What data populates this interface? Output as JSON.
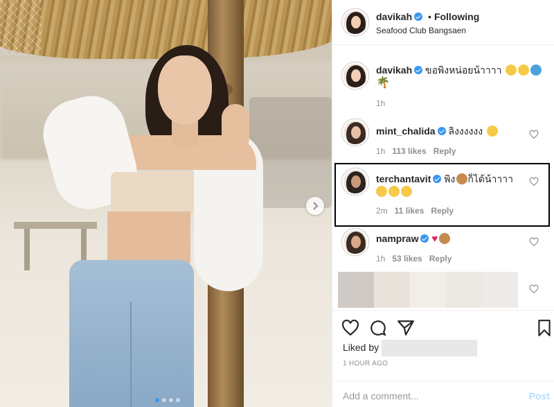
{
  "post": {
    "username": "davikah",
    "follow_status": "Following",
    "location": "Seafood Club Bangsaen"
  },
  "comments": [
    {
      "username": "davikah",
      "text": "ขอพิงหน่อยน้าาาา",
      "emojis": [
        "smile",
        "yum",
        "wave",
        "palm"
      ],
      "time": "1h"
    },
    {
      "username": "mint_chalida",
      "text": "ลิงงงงงง",
      "emojis": [
        "heart-eyes"
      ],
      "time": "1h",
      "likes": "113 likes",
      "reply": "Reply"
    },
    {
      "username": "terchantavit",
      "text_before": "พิง",
      "text_after": "ก็ได้น้าาาา",
      "emojis": [
        "monkey",
        "rofl",
        "rofl",
        "rofl"
      ],
      "time": "2m",
      "likes": "11 likes",
      "reply": "Reply"
    },
    {
      "username": "nampraw",
      "emojis": [
        "red-heart",
        "see-no-evil"
      ],
      "time": "1h",
      "likes": "53 likes",
      "reply": "Reply"
    }
  ],
  "actions": {
    "liked_by": "Liked by",
    "timestamp": "1 HOUR AGO"
  },
  "comment_box": {
    "placeholder": "Add a comment...",
    "post_label": "Post"
  },
  "colors": {
    "verified": "#3897f0",
    "meta": "#8e8e8e",
    "post_disabled": "#b2dffc"
  }
}
